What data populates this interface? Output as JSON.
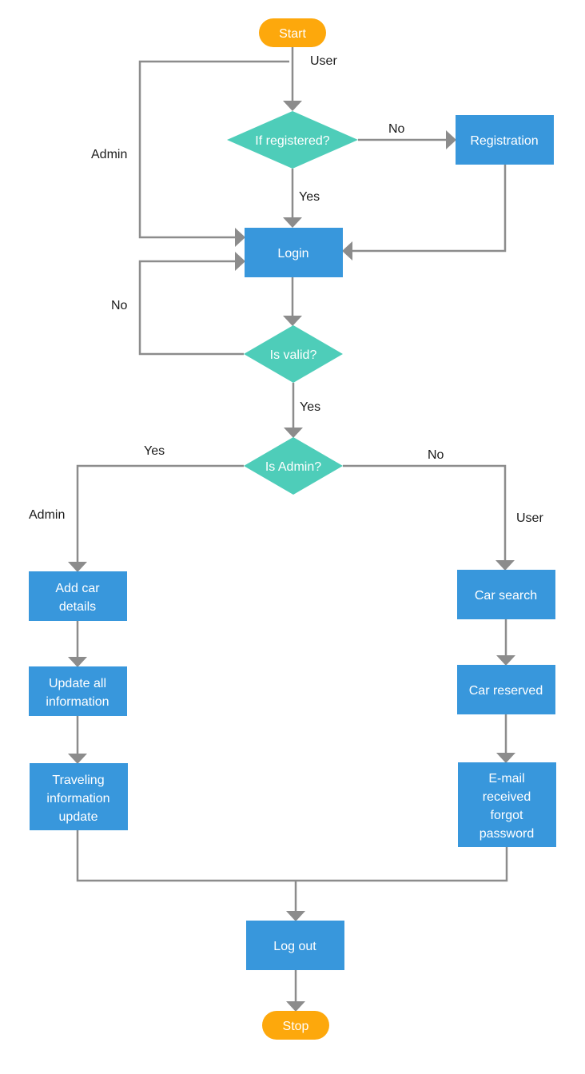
{
  "colors": {
    "terminal": "#FDA80C",
    "decision": "#4ECDB9",
    "process": "#3897DC",
    "connector": "#8C8C8C"
  },
  "nodes": {
    "start": "Start",
    "if_registered": "If registered?",
    "registration": "Registration",
    "login": "Login",
    "is_valid": "Is valid?",
    "is_admin": "Is Admin?",
    "add_car_details": [
      "Add car",
      "details"
    ],
    "update_all_information": [
      "Update all",
      "information"
    ],
    "traveling_information_update": [
      "Traveling",
      "information",
      "update"
    ],
    "car_search": "Car search",
    "car_reserved": "Car reserved",
    "email_received": [
      "E-mail",
      "received",
      "forgot",
      "password"
    ],
    "log_out": "Log out",
    "stop": "Stop"
  },
  "edge_labels": {
    "start_user": "User",
    "start_admin": "Admin",
    "registered_no": "No",
    "registered_yes": "Yes",
    "valid_no": "No",
    "valid_yes": "Yes",
    "admin_yes": "Yes",
    "admin_no": "No",
    "branch_admin": "Admin",
    "branch_user": "User"
  }
}
